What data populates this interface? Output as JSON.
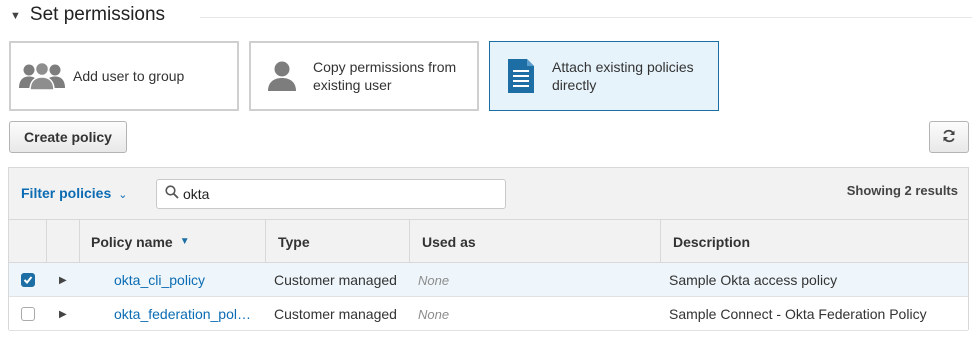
{
  "section": {
    "title": "Set permissions",
    "collapse_icon": "caret-down-icon"
  },
  "options": [
    {
      "label": "Add user to group",
      "icon": "users-group-icon",
      "selected": false
    },
    {
      "label": "Copy permissions from existing user",
      "icon": "user-icon",
      "selected": false
    },
    {
      "label": "Attach existing policies directly",
      "icon": "document-icon",
      "selected": true
    }
  ],
  "toolbar": {
    "create_policy_label": "Create policy",
    "refresh_icon": "refresh-icon"
  },
  "filter": {
    "label": "Filter policies",
    "search_value": "okta",
    "results_text": "Showing 2 results"
  },
  "table": {
    "columns": {
      "name": "Policy name",
      "type": "Type",
      "used_as": "Used as",
      "description": "Description"
    },
    "sort_column": "Policy name",
    "rows": [
      {
        "checked": true,
        "name": "okta_cli_policy",
        "type": "Customer managed",
        "used_as": "None",
        "description": "Sample Okta access policy"
      },
      {
        "checked": false,
        "name": "okta_federation_pol…",
        "type": "Customer managed",
        "used_as": "None",
        "description": "Sample Connect - Okta Federation Policy"
      }
    ]
  },
  "colors": {
    "accent": "#1c6ea4",
    "link": "#0b6cb3",
    "selected_bg": "#e6f3fb"
  }
}
